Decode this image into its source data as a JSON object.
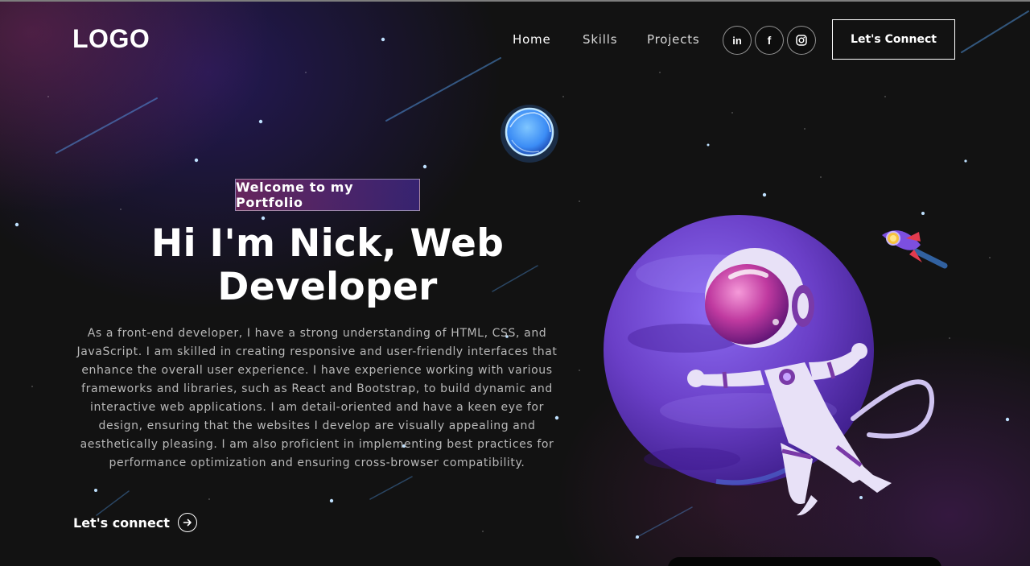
{
  "nav": {
    "logo": "LOGO",
    "links": [
      {
        "label": "Home",
        "active": true
      },
      {
        "label": "Skills",
        "active": false
      },
      {
        "label": "Projects",
        "active": false
      }
    ],
    "social": [
      {
        "icon": "linkedin-icon",
        "glyph": "in"
      },
      {
        "icon": "facebook-icon",
        "glyph": "f"
      },
      {
        "icon": "instagram-icon",
        "glyph": ""
      }
    ],
    "cta_label": "Let's Connect"
  },
  "hero": {
    "tagline": "Welcome to my Portfolio",
    "title_line1": "Hi I'm Nick, Web",
    "title_line2": "Developer",
    "description": "As a front-end developer, I have a strong understanding of HTML, CSS, and JavaScript. I am skilled in creating responsive and user-friendly interfaces that enhance the overall user experience. I have experience working with various frameworks and libraries, such as React and Bootstrap, to build dynamic and interactive web applications. I am detail-oriented and have a keen eye for design, ensuring that the websites I develop are visually appealing and aesthetically pleasing. I am also proficient in implementing best practices for performance optimization and ensuring cross-browser compatibility.",
    "connect_label": "Let's connect",
    "connect_icon": "arrow-right-circle-icon"
  },
  "illustration": {
    "planet_icon": "purple-planet",
    "astronaut_icon": "floating-astronaut",
    "moon_icon": "blue-moon",
    "rocket_icon": "small-rocket"
  },
  "colors": {
    "background": "#121212",
    "tagline_gradient_start": "#aa367c",
    "tagline_gradient_end": "#4a2fbd",
    "text_muted": "#b8b8b8",
    "planet": "#6a3fc7"
  }
}
